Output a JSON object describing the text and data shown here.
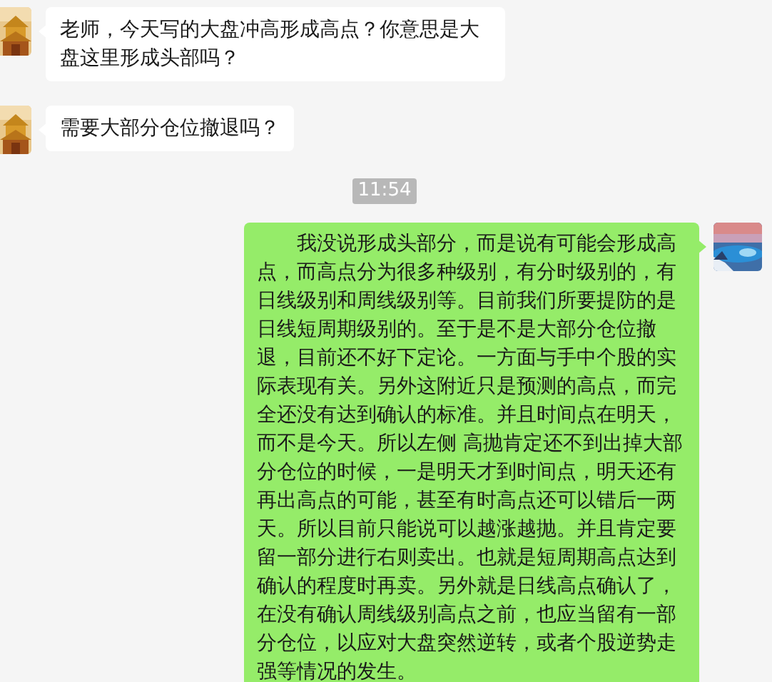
{
  "messages": [
    {
      "kind": "incoming",
      "text": "老师，今天写的大盘冲高形成高点？你意思是大盘这里形成头部吗？"
    },
    {
      "kind": "incoming",
      "text": "需要大部分仓位撤退吗？"
    },
    {
      "kind": "time",
      "text": "11:54"
    },
    {
      "kind": "outgoing",
      "text": "我没说形成头部分，而是说有可能会形成高点，而高点分为很多种级别，有分时级别的，有日线级别和周线级别等。目前我们所要提防的是日线短周期级别的。至于是不是大部分仓位撤退，目前还不好下定论。一方面与手中个股的实际表现有关。另外这附近只是预测的高点，而完全还没有达到确认的标准。并且时间点在明天，而不是今天。所以左侧 高抛肯定还不到出掉大部分仓位的时候，一是明天才到时间点，明天还有再出高点的可能，甚至有时高点还可以错后一两天。所以目前只能说可以越涨越抛。并且肯定要留一部分进行右则卖出。也就是短周期高点达到确认的程度时再卖。另外就是日线高点确认了，在没有确认周线级别高点之前，也应当留有一部分仓位，以应对大盘突然逆转，或者个股逆势走强等情况的发生。"
    }
  ]
}
